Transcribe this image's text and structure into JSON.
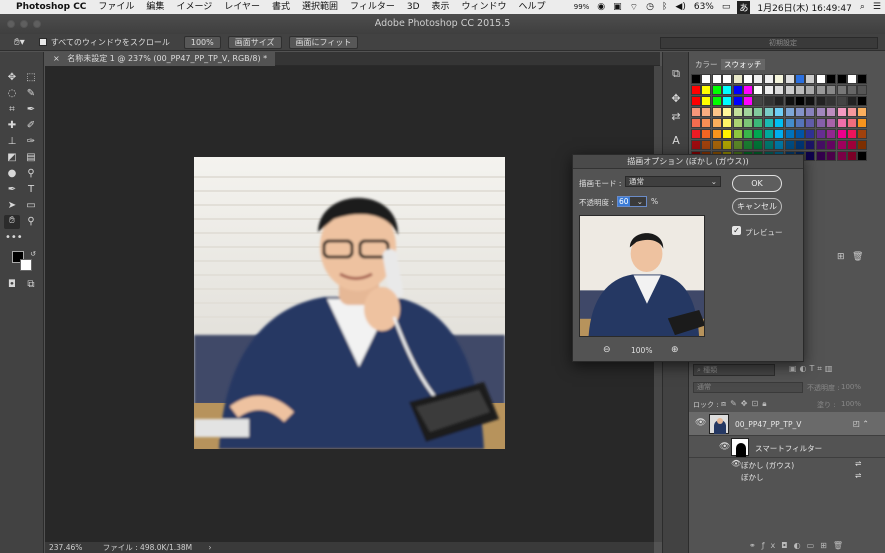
{
  "menubar": {
    "apple": "",
    "app": "Photoshop CC",
    "items": [
      "ファイル",
      "編集",
      "イメージ",
      "レイヤー",
      "書式",
      "選択範囲",
      "フィルター",
      "3D",
      "表示",
      "ウィンドウ",
      "ヘルプ"
    ],
    "status_percent": "99%",
    "battery": "63%",
    "ime": "あ",
    "datetime": "1月26日(木) 16:49:47"
  },
  "window": {
    "title": "Adobe Photoshop CC 2015.5"
  },
  "options_bar": {
    "scroll_all_label": "すべてのウィンドウをスクロール",
    "zoom_btn": "100%",
    "fit_screen_btn": "画面サイズ",
    "fill_screen_btn": "画面にフィット",
    "workspace": "初期設定"
  },
  "document": {
    "tab_title": "名称未設定 1 @ 237% (00_PP47_PP_TP_V, RGB/8) *",
    "zoom": "237.46%",
    "file_info": "ファイル : 498.0K/1.38M"
  },
  "swatches_panel": {
    "tab_color": "カラー",
    "tab_swatches": "スウォッチ"
  },
  "layers_panel": {
    "search_placeholder": "種類",
    "blend_mode": "通常",
    "opacity_label": "不透明度 :",
    "opacity_value": "100%",
    "lock_label": "ロック :",
    "fill_label": "塗り :",
    "fill_value": "100%",
    "layer_name": "00_PP47_PP_TP_V",
    "smart_filter": "スマートフィルター",
    "filter1": "ぼかし (ガウス)",
    "filter2": "ぼかし"
  },
  "dialog": {
    "title": "描画オプション (ぼかし (ガウス))",
    "mode_label": "描画モード :",
    "mode_value": "通常",
    "opacity_label": "不透明度 :",
    "opacity_value": "60",
    "percent": "%",
    "ok": "OK",
    "cancel": "キャンセル",
    "preview_label": "プレビュー",
    "preview_zoom": "100%"
  },
  "colors": {
    "accent": "#3b7bd5",
    "panel": "#535353",
    "canvas": "#282828"
  }
}
